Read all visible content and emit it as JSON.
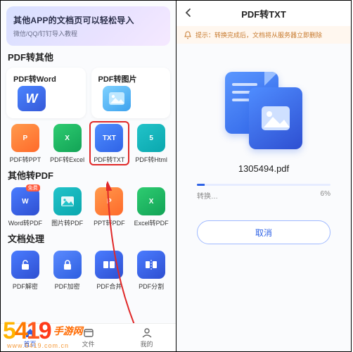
{
  "left": {
    "banner": {
      "title": "其他APP的文档页可以轻松导入",
      "sub": "微信/QQ/钉钉导入教程"
    },
    "sec1": {
      "title": "PDF转其他",
      "big": [
        {
          "label": "PDF转Word"
        },
        {
          "label": "PDF转图片"
        }
      ],
      "grid": [
        {
          "label": "PDF转PPT",
          "icon": "P"
        },
        {
          "label": "PDF转Excel",
          "icon": "X"
        },
        {
          "label": "PDF转TXT",
          "icon": "TXT"
        },
        {
          "label": "PDF转Html",
          "icon": "5"
        }
      ]
    },
    "sec2": {
      "title": "其他转PDF",
      "grid": [
        {
          "label": "Word转PDF",
          "icon": "W",
          "badge": "免费"
        },
        {
          "label": "图片转PDF",
          "icon": ""
        },
        {
          "label": "PPT转PDF",
          "icon": "P"
        },
        {
          "label": "Excel转PDF",
          "icon": "X"
        }
      ]
    },
    "sec3": {
      "title": "文档处理",
      "grid": [
        {
          "label": "PDF解密",
          "icon": ""
        },
        {
          "label": "PDF加密",
          "icon": ""
        },
        {
          "label": "PDF合并",
          "icon": ""
        },
        {
          "label": "PDF分割",
          "icon": ""
        }
      ]
    },
    "nav": [
      {
        "label": "首页"
      },
      {
        "label": "文件"
      },
      {
        "label": "我的"
      }
    ]
  },
  "right": {
    "title": "PDF转TXT",
    "tip_prefix": "提示：",
    "tip": "转换完成后，文档将从服务器立即删除",
    "filename": "1305494.pdf",
    "progress_label": "转换…",
    "progress_pct": "6%",
    "cancel": "取消"
  },
  "watermark": {
    "digits": [
      "5",
      "4",
      "1",
      "9"
    ],
    "suffix": "手游网",
    "url": "www.5419.com.cn"
  }
}
